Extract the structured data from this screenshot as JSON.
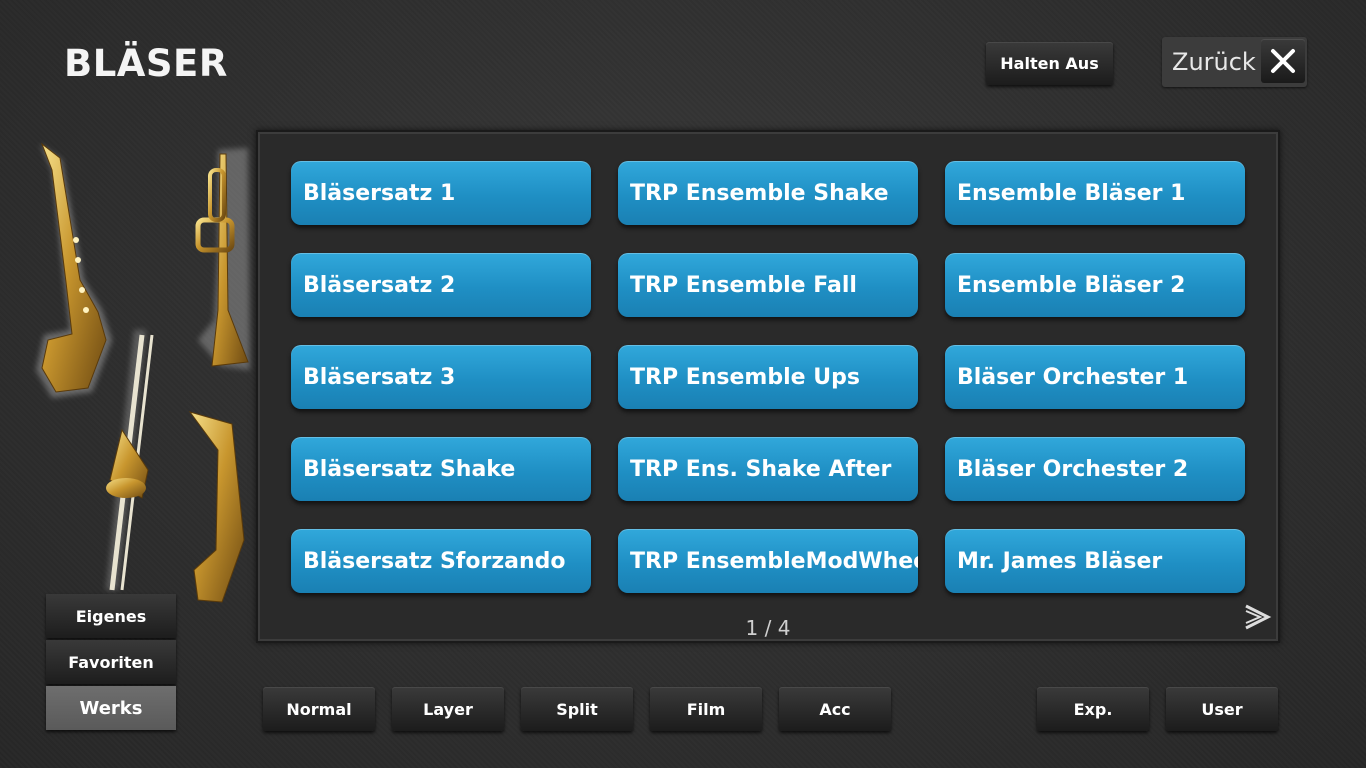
{
  "header": {
    "title": "BLÄSER",
    "halten_label": "Halten Aus",
    "back_label": "Zurück"
  },
  "sounds": [
    [
      "Bläsersatz 1",
      "TRP Ensemble Shake",
      "Ensemble Bläser 1"
    ],
    [
      "Bläsersatz 2",
      "TRP Ensemble Fall",
      "Ensemble Bläser 2"
    ],
    [
      "Bläsersatz 3",
      "TRP Ensemble Ups",
      "Bläser Orchester 1"
    ],
    [
      "Bläsersatz Shake",
      "TRP Ens. Shake After",
      "Bläser Orchester 2"
    ],
    [
      "Bläsersatz Sforzando",
      "TRP EnsembleModWheel",
      "Mr. James Bläser"
    ]
  ],
  "pagination": {
    "text": "1 / 4"
  },
  "category": {
    "items": [
      "Eigenes",
      "Favoriten",
      "Werks"
    ],
    "active": "Werks"
  },
  "bottom_bar": {
    "modes": [
      "Normal",
      "Layer",
      "Split",
      "Film",
      "Acc"
    ],
    "right": [
      "Exp.",
      "User"
    ]
  },
  "colors": {
    "sound_button": "#1f8fc4",
    "background": "#2e2e2e"
  }
}
